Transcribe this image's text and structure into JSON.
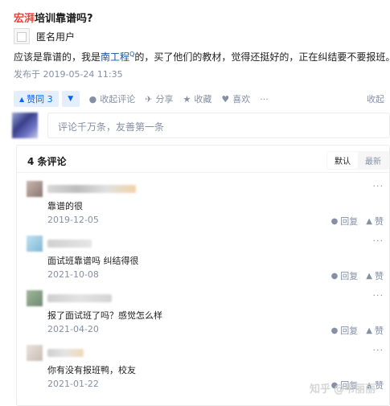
{
  "question": {
    "highlight": "宏湃",
    "rest": "培训靠谱吗?"
  },
  "author": {
    "name": "匿名用户"
  },
  "answer": {
    "text_before": "应该是靠谱的，我是",
    "link": "南工程",
    "sup": "Q",
    "text_after": "的，买了他们的教材，觉得还挺好的，正在纠结要不要报班。。",
    "published": "发布于 2019-05-24 11:35"
  },
  "actions": {
    "vote_label": "赞同 3",
    "vote_up_icon": "triangle-up-icon",
    "vote_down_icon": "triangle-down-icon",
    "collapse_comments": "收起评论",
    "share": "分享",
    "favorite": "收藏",
    "like": "喜欢",
    "more": "···",
    "collapse": "收起"
  },
  "comment_input": {
    "placeholder": "评论千万条，友善第一条"
  },
  "comments_panel": {
    "count_label": "4 条评论",
    "sort_default": "默认",
    "sort_latest": "最新",
    "items": [
      {
        "text": "靠谱的很",
        "date": "2019-12-05",
        "reply": "回复",
        "like": "赞",
        "more": "···"
      },
      {
        "text": "面试班靠谱吗 纠结得很",
        "date": "2021-10-08",
        "reply": "回复",
        "like": "赞",
        "more": "···"
      },
      {
        "text": "报了面试班了吗？感觉怎么样",
        "date": "2021-04-20",
        "reply": "回复",
        "like": "赞",
        "more": "···"
      },
      {
        "text": "你有没有报班鸭，校友",
        "date": "2021-01-22",
        "reply": "回复",
        "like": "赞",
        "more": "···"
      }
    ]
  },
  "watermark": "知乎 @韦丽丽",
  "colors": {
    "accent": "#0066ff",
    "highlight": "#f1403c",
    "muted": "#8590a6"
  }
}
